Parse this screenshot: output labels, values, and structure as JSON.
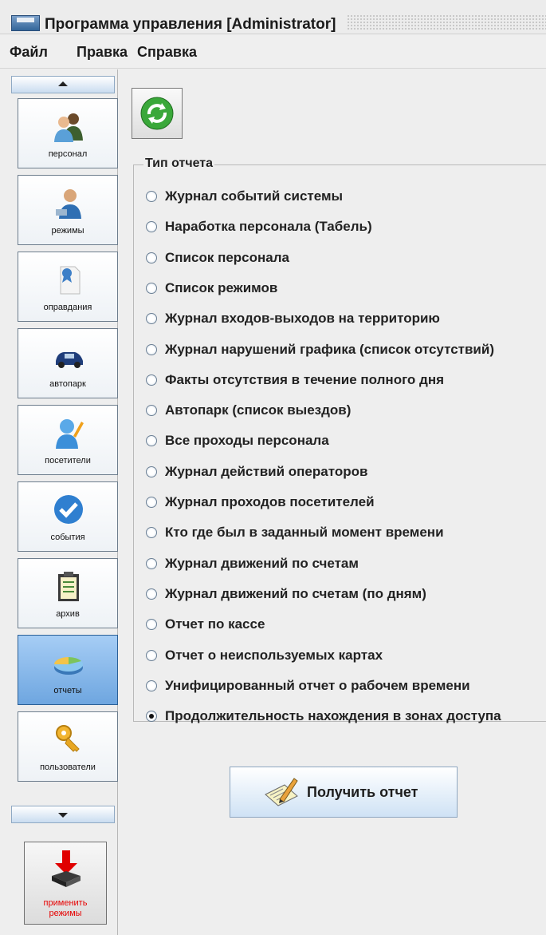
{
  "window": {
    "title": "Программа управления [Administrator]"
  },
  "menu": [
    "Файл",
    "Правка",
    "Справка"
  ],
  "sidebar": {
    "items": [
      {
        "label": "персонал",
        "icon": "people-icon"
      },
      {
        "label": "режимы",
        "icon": "person-computer-icon"
      },
      {
        "label": "оправдания",
        "icon": "document-ribbon-icon"
      },
      {
        "label": "автопарк",
        "icon": "car-icon"
      },
      {
        "label": "посетители",
        "icon": "visitor-pencil-icon"
      },
      {
        "label": "события",
        "icon": "checkmark-icon"
      },
      {
        "label": "архив",
        "icon": "clipboard-icon"
      },
      {
        "label": "отчеты",
        "icon": "pie-chart-icon",
        "active": true
      },
      {
        "label": "пользователи",
        "icon": "key-icon"
      }
    ],
    "apply": {
      "line1": "применить",
      "line2": "режимы"
    }
  },
  "report_group": {
    "legend": "Тип отчета",
    "options": [
      "Журнал событий системы",
      "Наработка персонала (Табель)",
      "Список персонала",
      "Список режимов",
      "Журнал входов-выходов на территорию",
      "Журнал нарушений графика (список отсутствий)",
      "Факты отсутствия в течение полного дня",
      "Автопарк (список выездов)",
      "Все проходы персонала",
      "Журнал действий операторов",
      "Журнал проходов посетителей",
      "Кто где был в заданный момент времени",
      "Журнал движений по счетам",
      "Журнал движений по счетам (по дням)",
      "Отчет по кассе",
      "Отчет о неиспользуемых картах",
      "Унифицированный отчет о рабочем времени",
      "Продолжительность нахождения в зонах доступа"
    ],
    "selected": "Продолжительность нахождения в зонах доступа"
  },
  "actions": {
    "get_report": "Получить отчет"
  },
  "colors": {
    "accent": "#5b9be0",
    "apply_text": "#e60000",
    "refresh": "#3aa83a"
  }
}
